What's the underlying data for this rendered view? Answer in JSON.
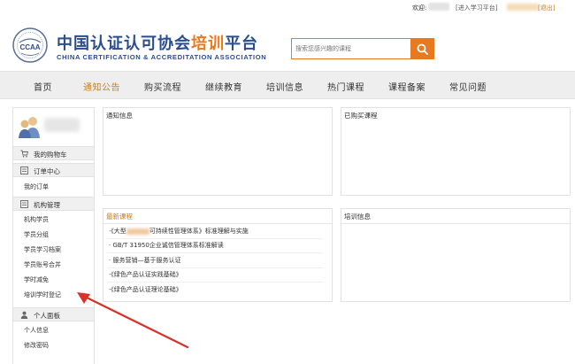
{
  "topbar": {
    "welcome": "欢迎:",
    "enter_study": "[进入学习平台]",
    "exit": "[退出]"
  },
  "header": {
    "logo_badge": "CCAA",
    "logo_cn_a": "中国认证认可协会",
    "logo_cn_b": "培训",
    "logo_cn_c": "平台",
    "logo_en": "CHINA CERTIFICATION & ACCREDITATION ASSOCIATION",
    "search_placeholder": "搜索您感兴趣的课程",
    "search_icon": "search-icon"
  },
  "nav": {
    "items": [
      {
        "label": "首页"
      },
      {
        "label": "通知公告",
        "active": true
      },
      {
        "label": "购买流程"
      },
      {
        "label": "继续教育"
      },
      {
        "label": "培训信息"
      },
      {
        "label": "热门课程"
      },
      {
        "label": "课程备案"
      },
      {
        "label": "常见问题"
      }
    ]
  },
  "sidebar": {
    "cart": {
      "label": "我的购物车",
      "icon": "cart-icon"
    },
    "orders": {
      "label": "订单中心",
      "icon": "list-icon",
      "items": [
        "我的订单"
      ]
    },
    "org": {
      "label": "机构管理",
      "icon": "list-icon",
      "items": [
        "机构学员",
        "学员分组",
        "学员学习档案",
        "学员账号合并",
        "学时减免",
        "培训学时登记"
      ]
    },
    "personal": {
      "label": "个人面板",
      "icon": "person-icon",
      "items": [
        "个人信息",
        "修改密码"
      ]
    }
  },
  "panels": {
    "notice": {
      "title": "通知信息"
    },
    "purchased": {
      "title": "已购买课程"
    },
    "newest": {
      "title": "最新课程",
      "courses": [
        {
          "prefix": "·《大型",
          "suffix": "可持续性管理体系》标准理解与实施"
        },
        {
          "prefix": "· GB/T 31950企业诚信管理体系标准解读",
          "suffix": ""
        },
        {
          "prefix": "· 服务营销—基于服务认证",
          "suffix": ""
        },
        {
          "prefix": "·《绿色产品认证实践基础》",
          "suffix": ""
        },
        {
          "prefix": "·《绿色产品认证理论基础》",
          "suffix": ""
        }
      ]
    },
    "training": {
      "title": "培训信息"
    }
  },
  "colors": {
    "brand_blue": "#2a4d8f",
    "accent_orange": "#e8791e",
    "arrow_red": "#d9302a"
  }
}
